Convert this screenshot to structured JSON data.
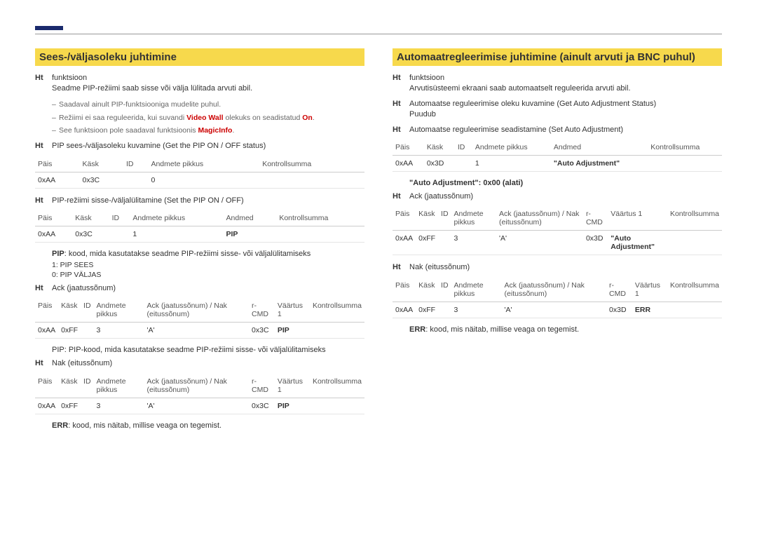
{
  "left": {
    "heading": "Sees-/väljasoleku juhtimine",
    "func_label": "Ht",
    "func_title": "funktsioon",
    "func_desc": "Seadme PIP-režiimi saab sisse või välja lülitada arvuti abil.",
    "notes": [
      "Saadaval ainult PIP-funktsiooniga mudelite puhul.",
      "Režiimi ei saa reguleerida, kui suvandi ",
      "See funktsioon pole saadaval funktsioonis "
    ],
    "video_wall": "Video Wall",
    "video_wall_tail": " olekuks on seadistatud ",
    "on": "On",
    "magic": "MagicInfo",
    "get_label": "Ht",
    "get_title": "PIP sees-/väljasoleku kuvamine (Get the PIP ON / OFF status)",
    "get_table": {
      "headers": [
        "Päis",
        "Käsk",
        "ID",
        "Andmete pikkus",
        "Kontrollsumma"
      ],
      "cells": [
        "0xAA",
        "0x3C",
        "",
        "0",
        ""
      ]
    },
    "set_label": "Ht",
    "set_title": "PIP-režiimi sisse-/väljalülitamine (Set the PIP ON / OFF)",
    "set_table": {
      "headers": [
        "Päis",
        "Käsk",
        "ID",
        "Andmete pikkus",
        "Andmed",
        "Kontrollsumma"
      ],
      "cells": [
        "0xAA",
        "0x3C",
        "",
        "1",
        "PIP",
        ""
      ]
    },
    "pip_desc": "PIP: kood, mida kasutatakse seadme PIP-režiimi sisse- või väljalülitamiseks",
    "pip_sees": "1: PIP SEES",
    "pip_valjas": "0: PIP VÄLJAS",
    "ack_label": "Ht",
    "ack_title": "Ack (jaatussõnum)",
    "ack_table": {
      "headers": [
        "Päis",
        "Käsk",
        "ID",
        "Andmete pikkus",
        "Ack (jaatussõnum) / Nak (eitussõnum)",
        "r-CMD",
        "Väärtus 1",
        "Kontrollsumma"
      ],
      "cells": [
        "0xAA",
        "0xFF",
        "",
        "3",
        "'A'",
        "0x3C",
        "PIP",
        ""
      ]
    },
    "pip_desc2": "PIP: PIP-kood, mida kasutatakse seadme PIP-režiimi sisse- või väljalülitamiseks",
    "nak_label": "Ht",
    "nak_title": "Nak (eitussõnum)",
    "nak_table": {
      "headers": [
        "Päis",
        "Käsk",
        "ID",
        "Andmete pikkus",
        "Ack (jaatussõnum) / Nak (eitussõnum)",
        "r-CMD",
        "Väärtus 1",
        "Kontrollsumma"
      ],
      "cells": [
        "0xAA",
        "0xFF",
        "",
        "3",
        "'A'",
        "0x3C",
        "PIP",
        ""
      ]
    },
    "err_desc": "ERR: kood, mis näitab, millise veaga on tegemist."
  },
  "right": {
    "heading": "Automaatregleerimise juhtimine (ainult arvuti ja BNC puhul)",
    "func_label": "Ht",
    "func_title": "funktsioon",
    "func_desc": "Arvutisüsteemi ekraani saab automaatselt reguleerida arvuti abil.",
    "get_label": "Ht",
    "get_title": "Automaatse reguleerimise oleku kuvamine (Get Auto Adjustment Status)",
    "get_none": "Puudub",
    "set_label": "Ht",
    "set_title": "Automaatse reguleerimise seadistamine (Set Auto Adjustment)",
    "set_table": {
      "headers": [
        "Päis",
        "Käsk",
        "ID",
        "Andmete pikkus",
        "Andmed",
        "Kontrollsumma"
      ],
      "cells": [
        "0xAA",
        "0x3D",
        "",
        "1",
        "\"Auto Adjustment\"",
        ""
      ]
    },
    "auto_adj_note": "\"Auto Adjustment\": 0x00 (alati)",
    "ack_label": "Ht",
    "ack_title": "Ack (jaatussõnum)",
    "ack_table": {
      "headers": [
        "Päis",
        "Käsk",
        "ID",
        "Andmete pikkus",
        "Ack (jaatussõnum) / Nak (eitussõnum)",
        "r-CMD",
        "Väärtus 1",
        "Kontrollsumma"
      ],
      "cells": [
        "0xAA",
        "0xFF",
        "",
        "3",
        "'A'",
        "0x3D",
        "\"Auto Adjustment\"",
        ""
      ]
    },
    "nak_label": "Ht",
    "nak_title": "Nak (eitussõnum)",
    "nak_table": {
      "headers": [
        "Päis",
        "Käsk",
        "ID",
        "Andmete pikkus",
        "Ack (jaatussõnum) / Nak (eitussõnum)",
        "r-CMD",
        "Väärtus 1",
        "Kontrollsumma"
      ],
      "cells": [
        "0xAA",
        "0xFF",
        "",
        "3",
        "'A'",
        "0x3D",
        "ERR",
        ""
      ]
    },
    "err_desc": "ERR: kood, mis näitab, millise veaga on tegemist."
  }
}
